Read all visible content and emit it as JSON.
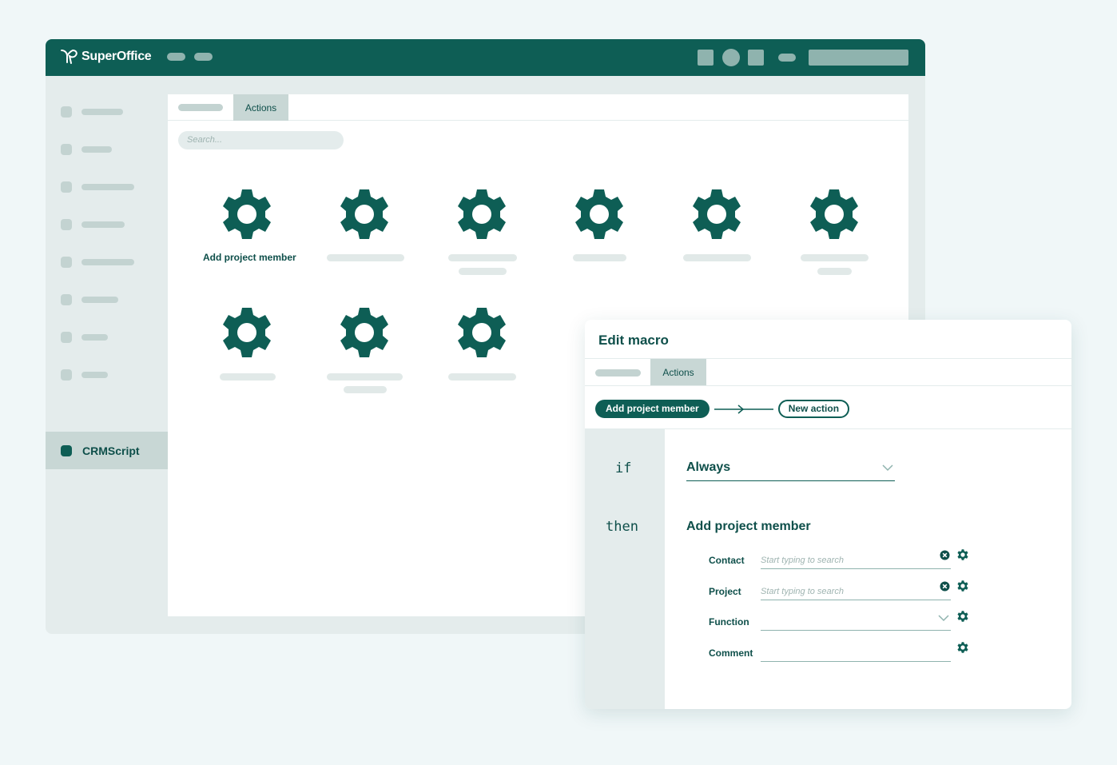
{
  "app": {
    "brand": "SuperOffice",
    "colors": {
      "primary": "#0e5e55",
      "accent_light": "#c8d7d5",
      "placeholder": "#e1e9e8",
      "background": "#f0f7f8"
    }
  },
  "sidebar": {
    "active_label": "CRMScript"
  },
  "main": {
    "tab_active": "Actions",
    "search_placeholder": "Search...",
    "actions": [
      {
        "icon": "gear-icon",
        "label": "Add project member"
      }
    ]
  },
  "macro": {
    "title": "Edit macro",
    "tab_active": "Actions",
    "flow": {
      "current": "Add project member",
      "new": "New action"
    },
    "if_keyword": "if",
    "then_keyword": "then",
    "condition": "Always",
    "action_title": "Add project member",
    "fields": [
      {
        "label": "Contact",
        "placeholder": "Start typing to search"
      },
      {
        "label": "Project",
        "placeholder": "Start typing to search"
      },
      {
        "label": "Function",
        "placeholder": ""
      },
      {
        "label": "Comment",
        "placeholder": ""
      }
    ]
  }
}
